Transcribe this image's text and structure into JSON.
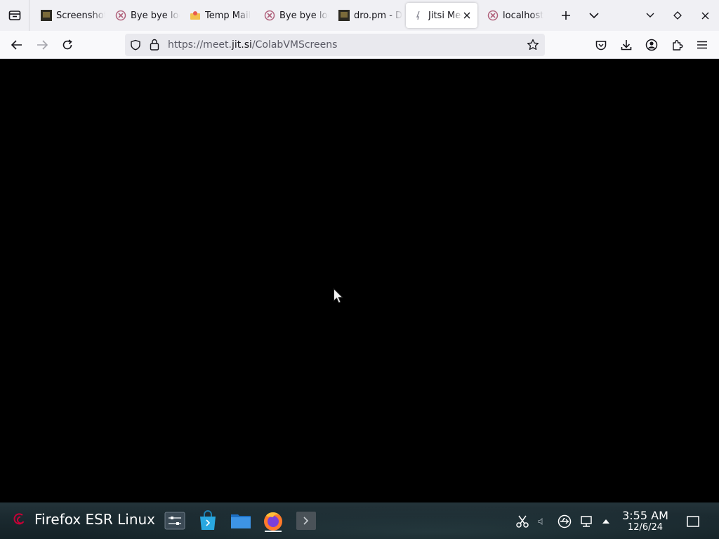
{
  "browser": {
    "tabs": [
      {
        "title": "Screenshot",
        "favicon": "screenshot-favicon"
      },
      {
        "title": "Bye bye login",
        "favicon": "pink-x-favicon"
      },
      {
        "title": "Temp Mail",
        "favicon": "temp-mail-favicon"
      },
      {
        "title": "Bye bye login",
        "favicon": "pink-x-favicon"
      },
      {
        "title": "dro.pm - D",
        "favicon": "dropm-favicon"
      },
      {
        "title": "Jitsi Meet",
        "favicon": "jitsi-favicon",
        "active": true
      },
      {
        "title": "localhost",
        "favicon": "pink-x-favicon"
      }
    ],
    "url": {
      "scheme": "https://meet.",
      "host": "jit.si",
      "path": "/ColabVMScreens"
    }
  },
  "taskbar": {
    "start_label": "Firefox ESR Linux",
    "clock_time": "3:55 AM",
    "clock_date": "12/6/24"
  },
  "colors": {
    "tabbar_bg": "#f0f0f4",
    "navbar_bg": "#f9f9fb",
    "content_bg": "#000000",
    "taskbar_bg": "#1b2a30"
  }
}
